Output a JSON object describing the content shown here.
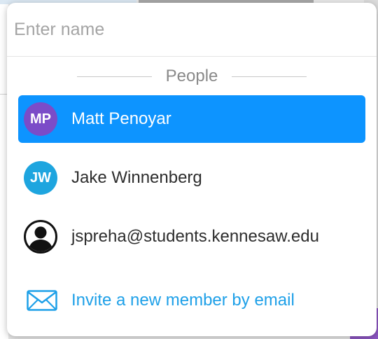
{
  "search": {
    "placeholder": "Enter name",
    "value": ""
  },
  "section": {
    "label": "People"
  },
  "people": [
    {
      "initials": "MP",
      "name": "Matt Penoyar",
      "selected": true,
      "avatar_color": "#7b4cc8"
    },
    {
      "initials": "JW",
      "name": "Jake Winnenberg",
      "selected": false,
      "avatar_color": "#1ea5df"
    },
    {
      "initials": "",
      "name": "jspreha@students.kennesaw.edu",
      "selected": false,
      "avatar_icon": "user-silhouette-icon"
    }
  ],
  "invite": {
    "label": "Invite a new member by email",
    "icon": "envelope-icon"
  },
  "colors": {
    "selected_row": "#0d94ff",
    "link": "#1ea0e8"
  }
}
